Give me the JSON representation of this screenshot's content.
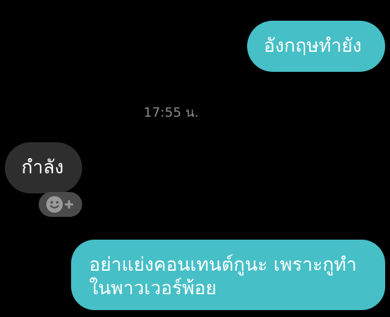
{
  "messages": {
    "outgoing_1": "อังกฤษทำยัง",
    "timestamp": "17:55 น.",
    "incoming_1": "กำลัง",
    "outgoing_2_line_1": "อย่าแย่งคอนเทนต์กูนะ เพราะกูทำ",
    "outgoing_2_line_2": "ในพาวเวอร์พ้อย"
  },
  "icons": {
    "reaction": "add-reaction-icon"
  },
  "colors": {
    "background": "#000000",
    "outgoing_bubble": "#46bfc7",
    "incoming_bubble": "#2e2e2e",
    "reaction_button": "#4a4a4a",
    "timestamp_text": "#8c8c8c",
    "message_text": "#ffffff"
  }
}
